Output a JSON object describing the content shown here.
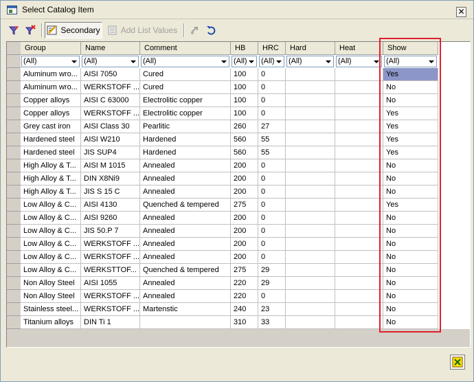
{
  "window": {
    "title": "Select Catalog Item",
    "close_glyph": "✕"
  },
  "toolbar": {
    "secondary_label": "Secondary",
    "add_list_values_label": "Add List Values"
  },
  "icons": {
    "tool1": "filter-icon",
    "tool2": "clear-filter-icon",
    "secondary": "secondary-icon",
    "add_list": "list-icon",
    "link": "link-icon",
    "undo": "undo-icon",
    "excel": "excel-export-icon"
  },
  "colors": {
    "highlight": "#e0202a",
    "selection": "#8c96c8"
  },
  "table": {
    "columns": [
      "Group",
      "Name",
      "Comment",
      "HB",
      "HRC",
      "Hard",
      "Heat",
      "Show"
    ],
    "filter_value": "(All)",
    "rows": [
      [
        "Aluminum wro...",
        "AISI 7050",
        "Cured",
        "100",
        "0",
        "",
        "",
        "Yes"
      ],
      [
        "Aluminum wro...",
        "WERKSTOFF ...",
        "Cured",
        "100",
        "0",
        "",
        "",
        "No"
      ],
      [
        "Copper alloys",
        "AISI C 63000",
        "Electrolitic copper",
        "100",
        "0",
        "",
        "",
        "No"
      ],
      [
        "Copper alloys",
        "WERKSTOFF ...",
        "Electrolitic copper",
        "100",
        "0",
        "",
        "",
        "Yes"
      ],
      [
        "Grey cast iron",
        "AISI Class 30",
        "Pearlitic",
        "260",
        "27",
        "",
        "",
        "Yes"
      ],
      [
        "Hardened steel",
        "AISI W210",
        "Hardened",
        "560",
        "55",
        "",
        "",
        "Yes"
      ],
      [
        "Hardened steel",
        "JIS SUP4",
        "Hardened",
        "560",
        "55",
        "",
        "",
        "Yes"
      ],
      [
        "High Alloy & T...",
        "AISI   M 1015",
        "Annealed",
        "200",
        "0",
        "",
        "",
        "No"
      ],
      [
        "High Alloy & T...",
        "DIN X8Ni9",
        "Annealed",
        "200",
        "0",
        "",
        "",
        "No"
      ],
      [
        "High Alloy & T...",
        "JIS S 15 C",
        "Annealed",
        "200",
        "0",
        "",
        "",
        "No"
      ],
      [
        "Low Alloy & C...",
        "AISI 4130",
        "Quenched & tempered",
        "275",
        "0",
        "",
        "",
        "Yes"
      ],
      [
        "Low Alloy & C...",
        "AISI 9260",
        "Annealed",
        "200",
        "0",
        "",
        "",
        "No"
      ],
      [
        "Low Alloy & C...",
        "JIS 50.P 7",
        "Annealed",
        "200",
        "0",
        "",
        "",
        "No"
      ],
      [
        "Low Alloy & C...",
        "WERKSTOFF ...",
        "Annealed",
        "200",
        "0",
        "",
        "",
        "No"
      ],
      [
        "Low Alloy & C...",
        "WERKSTOFF ...",
        "Annealed",
        "200",
        "0",
        "",
        "",
        "No"
      ],
      [
        "Low Alloy & C...",
        "WERKSTTOF...",
        "Quenched & tempered",
        "275",
        "29",
        "",
        "",
        "No"
      ],
      [
        "Non Alloy Steel",
        "AISI 1055",
        "Annealed",
        "220",
        "29",
        "",
        "",
        "No"
      ],
      [
        "Non Alloy Steel",
        "WERKSTOFF ...",
        "Annealed",
        "220",
        "0",
        "",
        "",
        "No"
      ],
      [
        "Stainless steel...",
        "WERKSTOFF ...",
        "Martenstic",
        "240",
        "23",
        "",
        "",
        "No"
      ],
      [
        "Titanium alloys",
        "DIN Ti 1",
        "",
        "310",
        "33",
        "",
        "",
        "No"
      ]
    ]
  }
}
